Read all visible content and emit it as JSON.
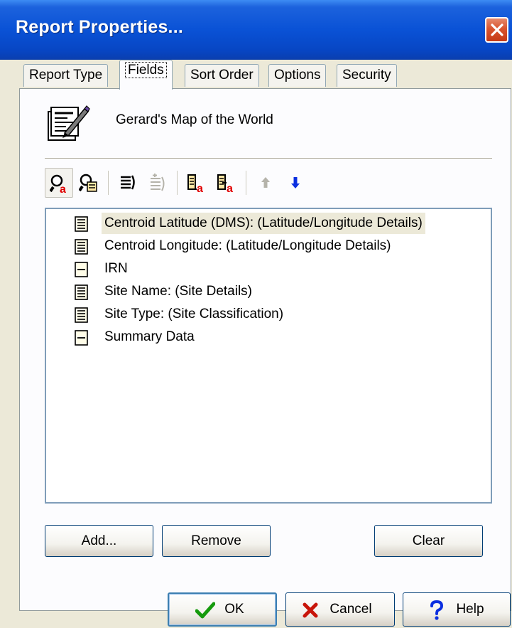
{
  "window": {
    "title": "Report Properties..."
  },
  "tabs": [
    {
      "label": "Report Type",
      "active": false
    },
    {
      "label": "Fields",
      "active": true
    },
    {
      "label": "Sort Order",
      "active": false
    },
    {
      "label": "Options",
      "active": false
    },
    {
      "label": "Security",
      "active": false
    }
  ],
  "report": {
    "name": "Gerard's Map of the World",
    "icon": "report-document-pen-icon"
  },
  "toolbar": {
    "buttons": [
      {
        "icon": "find-field-icon",
        "state": "pressed"
      },
      {
        "icon": "find-next-icon",
        "state": "normal"
      },
      {
        "icon": "expand-all-icon",
        "state": "normal"
      },
      {
        "icon": "collapse-all-icon",
        "state": "disabled"
      },
      {
        "icon": "add-field-before-icon",
        "state": "normal"
      },
      {
        "icon": "add-field-after-icon",
        "state": "normal"
      },
      {
        "icon": "move-up-icon",
        "state": "disabled"
      },
      {
        "icon": "move-down-icon",
        "state": "normal"
      }
    ]
  },
  "fields": [
    {
      "label": "Centroid Latitude (DMS): (Latitude/Longitude Details)",
      "icon": "text-field-icon",
      "selected": true
    },
    {
      "label": "Centroid Longitude: (Latitude/Longitude Details)",
      "icon": "text-field-icon",
      "selected": false
    },
    {
      "label": "IRN",
      "icon": "single-field-icon",
      "selected": false
    },
    {
      "label": "Site Name: (Site Details)",
      "icon": "text-field-icon",
      "selected": false
    },
    {
      "label": "Site Type: (Site Classification)",
      "icon": "text-field-icon",
      "selected": false
    },
    {
      "label": "Summary Data",
      "icon": "single-field-icon",
      "selected": false
    }
  ],
  "list_buttons": {
    "add": "Add...",
    "remove": "Remove",
    "clear": "Clear"
  },
  "dialog_buttons": {
    "ok": "OK",
    "cancel": "Cancel",
    "help": "Help"
  },
  "colors": {
    "titlebar": "#0a52d6",
    "dialog_bg": "#ece9d8",
    "selection": "#ece9d8",
    "list_border": "#7f9db9"
  }
}
